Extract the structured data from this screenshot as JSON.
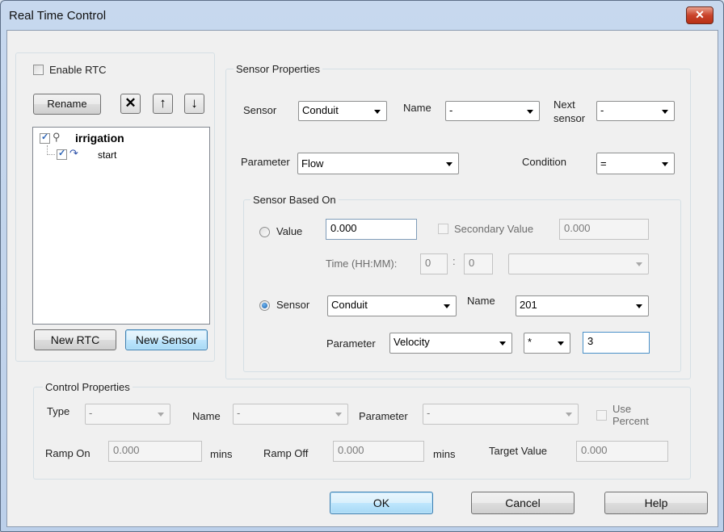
{
  "window": {
    "title": "Real Time Control",
    "close_glyph": "✕"
  },
  "rtc": {
    "enable_label": "Enable RTC",
    "enable_checked": false,
    "rename_label": "Rename",
    "delete_glyph": "✕",
    "up_glyph": "↑",
    "down_glyph": "↓",
    "tree": [
      {
        "label": "irrigation",
        "checked": true
      },
      {
        "label": "start",
        "checked": true
      }
    ],
    "new_rtc_label": "New RTC",
    "new_sensor_label": "New Sensor"
  },
  "sensor_props": {
    "legend": "Sensor Properties",
    "sensor_label": "Sensor",
    "sensor_value": "Conduit",
    "name_label": "Name",
    "name_value": "-",
    "next_sensor_label_1": "Next",
    "next_sensor_label_2": "sensor",
    "next_sensor_value": "-",
    "parameter_label": "Parameter",
    "parameter_value": "Flow",
    "condition_label": "Condition",
    "condition_value": "="
  },
  "based_on": {
    "legend": "Sensor Based On",
    "value_label": "Value",
    "value_selected": false,
    "value_text": "0.000",
    "secondary_label": "Secondary Value",
    "secondary_value": "0.000",
    "time_label": "Time (HH:MM):",
    "time_hh": "0",
    "time_sep": ":",
    "time_mm": "0",
    "time_combo_value": "",
    "sensor_label": "Sensor",
    "sensor_selected": true,
    "sensor_value": "Conduit",
    "name_label": "Name",
    "name_value": "201",
    "parameter_label": "Parameter",
    "parameter_value": "Velocity",
    "operator_value": "*",
    "factor_value": "3"
  },
  "control_props": {
    "legend": "Control Properties",
    "type_label": "Type",
    "type_value": "-",
    "name_label": "Name",
    "name_value": "-",
    "parameter_label": "Parameter",
    "parameter_value": "-",
    "use_percent_1": "Use",
    "use_percent_2": "Percent",
    "ramp_on_label": "Ramp On",
    "ramp_on_value": "0.000",
    "ramp_on_unit": "mins",
    "ramp_off_label": "Ramp Off",
    "ramp_off_value": "0.000",
    "ramp_off_unit": "mins",
    "target_label": "Target Value",
    "target_value": "0.000"
  },
  "footer": {
    "ok_label": "OK",
    "cancel_label": "Cancel",
    "help_label": "Help"
  }
}
